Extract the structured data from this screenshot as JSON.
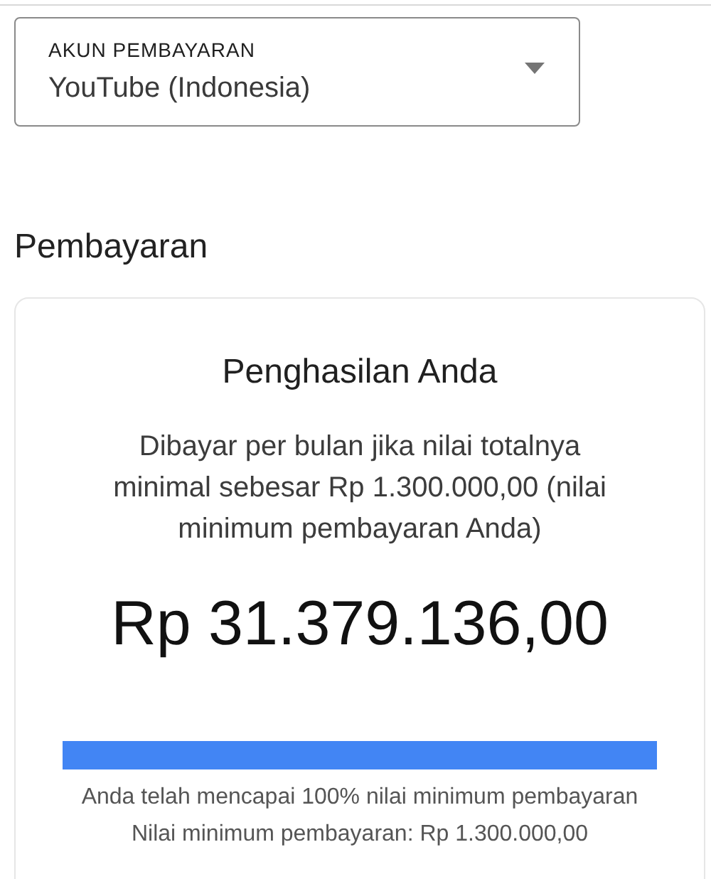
{
  "account_select": {
    "label": "AKUN PEMBAYARAN",
    "value": "YouTube (Indonesia)"
  },
  "section_title": "Pembayaran",
  "earnings_card": {
    "title": "Penghasilan Anda",
    "description": "Dibayar per bulan jika nilai totalnya minimal sebesar Rp 1.300.000,00 (nilai minimum pembayaran Anda)",
    "amount": "Rp 31.379.136,00",
    "progress": {
      "level": 1
    },
    "progress_text": "Anda telah mencapai 100% nilai minimum pembayaran",
    "threshold_text": "Nilai minimum pembayaran: Rp 1.300.000,00"
  }
}
